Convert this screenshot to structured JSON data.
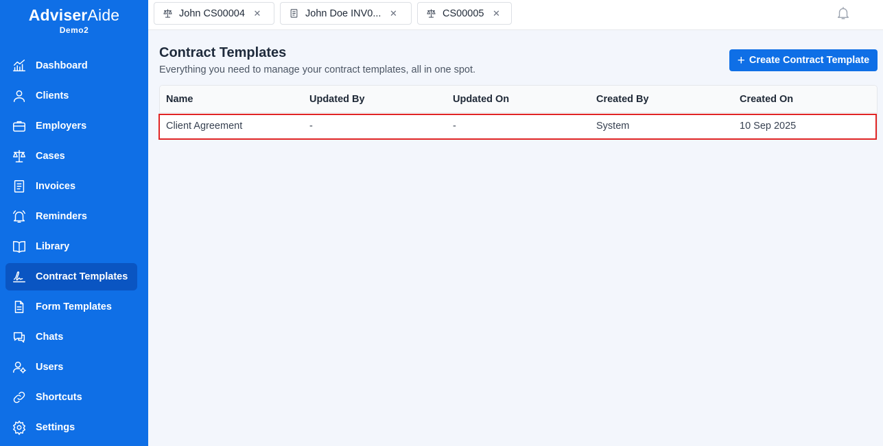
{
  "brand": {
    "name_bold": "Adviser",
    "name_light": "Aide",
    "subtitle": "Demo2"
  },
  "sidebar": {
    "items": [
      {
        "label": "Dashboard",
        "icon": "chart-icon"
      },
      {
        "label": "Clients",
        "icon": "user-icon"
      },
      {
        "label": "Employers",
        "icon": "briefcase-icon"
      },
      {
        "label": "Cases",
        "icon": "scales-icon"
      },
      {
        "label": "Invoices",
        "icon": "invoice-icon"
      },
      {
        "label": "Reminders",
        "icon": "bell-icon"
      },
      {
        "label": "Library",
        "icon": "book-icon"
      },
      {
        "label": "Contract Templates",
        "icon": "signature-icon",
        "active": true
      },
      {
        "label": "Form Templates",
        "icon": "document-icon"
      },
      {
        "label": "Chats",
        "icon": "chat-icon"
      },
      {
        "label": "Users",
        "icon": "user-gear-icon"
      },
      {
        "label": "Shortcuts",
        "icon": "link-icon"
      },
      {
        "label": "Settings",
        "icon": "gear-icon"
      }
    ]
  },
  "tabs": [
    {
      "label": "John CS00004",
      "icon": "scales-icon"
    },
    {
      "label": "John Doe INV0...",
      "icon": "invoice-icon"
    },
    {
      "label": "CS00005",
      "icon": "scales-icon"
    }
  ],
  "header": {
    "title": "Contract Templates",
    "subtitle": "Everything you need to manage your contract templates, all in one spot.",
    "create_button": "Create Contract Template"
  },
  "table": {
    "columns": [
      "Name",
      "Updated By",
      "Updated On",
      "Created By",
      "Created On"
    ],
    "rows": [
      [
        "Client Agreement",
        "-",
        "-",
        "System",
        "10 Sep 2025"
      ]
    ]
  },
  "colors": {
    "accent": "#0f6fe6",
    "sidebar_active": "#0a55c2",
    "highlight": "#e02424"
  }
}
